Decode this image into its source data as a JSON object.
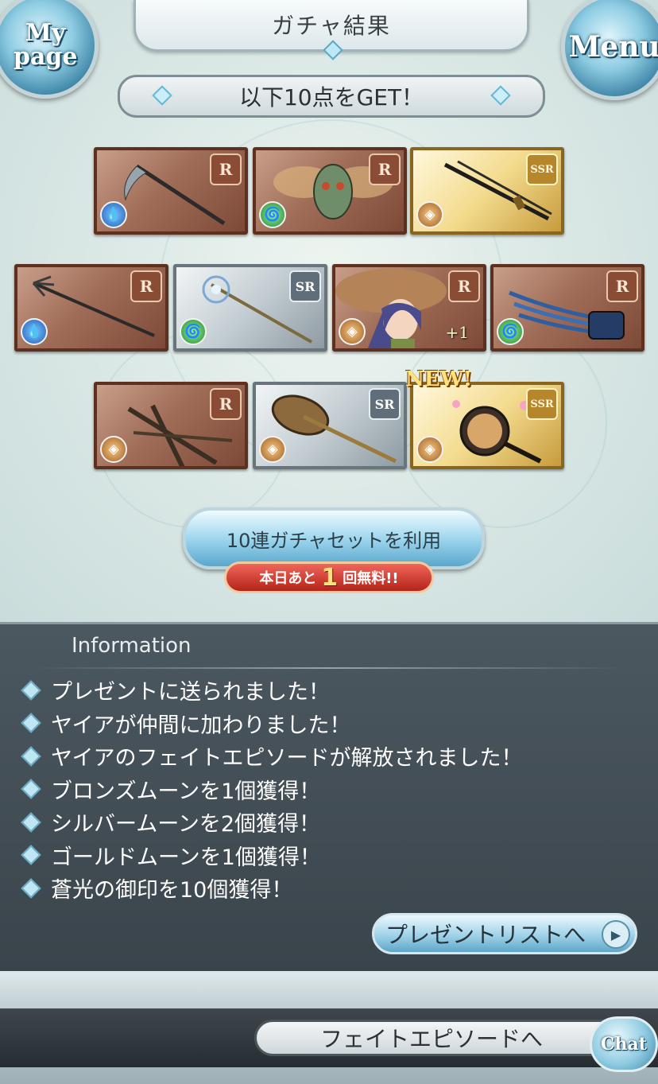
{
  "header": {
    "title": "ガチャ結果",
    "mypage_label": "My page",
    "menu_label": "Menu"
  },
  "banner": {
    "text": "以下10点をGET！"
  },
  "results": {
    "rows": [
      [
        {
          "rarity": "R",
          "element": "water",
          "item": "scythe"
        },
        {
          "rarity": "R",
          "element": "wind",
          "item": "insect-mask"
        },
        {
          "rarity": "SSR",
          "element": "earth",
          "item": "katana"
        }
      ],
      [
        {
          "rarity": "R",
          "element": "water",
          "item": "trident"
        },
        {
          "rarity": "SR",
          "element": "wind",
          "item": "staff"
        },
        {
          "rarity": "R",
          "element": "earth",
          "item": "character-yaia",
          "plus": "+1"
        },
        {
          "rarity": "R",
          "element": "wind",
          "item": "claws"
        }
      ],
      [
        {
          "rarity": "R",
          "element": "earth",
          "item": "crossed-sticks"
        },
        {
          "rarity": "SR",
          "element": "earth",
          "item": "great-axe"
        },
        {
          "rarity": "SSR",
          "element": "earth",
          "item": "frying-pan",
          "new": "NEW!"
        }
      ]
    ]
  },
  "gacha_button": {
    "label": "10連ガチャセットを利用",
    "free_prefix": "本日あと",
    "free_count": "1",
    "free_suffix": "回無料!!"
  },
  "info": {
    "title": "Information",
    "items": [
      "プレゼントに送られました！",
      "ヤイアが仲間に加わりました！",
      "ヤイアのフェイトエピソードが解放されました！",
      "ブロンズムーンを1個獲得！",
      "シルバームーンを2個獲得！",
      "ゴールドムーンを1個獲得！",
      "蒼光の御印を10個獲得！"
    ],
    "present_button": "プレゼントリストへ"
  },
  "footer": {
    "fate_button": "フェイトエピソードへ",
    "chat_label": "Chat"
  },
  "colors": {
    "water": "#1f5fb8",
    "wind": "#1f8a2e",
    "earth": "#a05f1f",
    "info_panel": "#46525a"
  }
}
